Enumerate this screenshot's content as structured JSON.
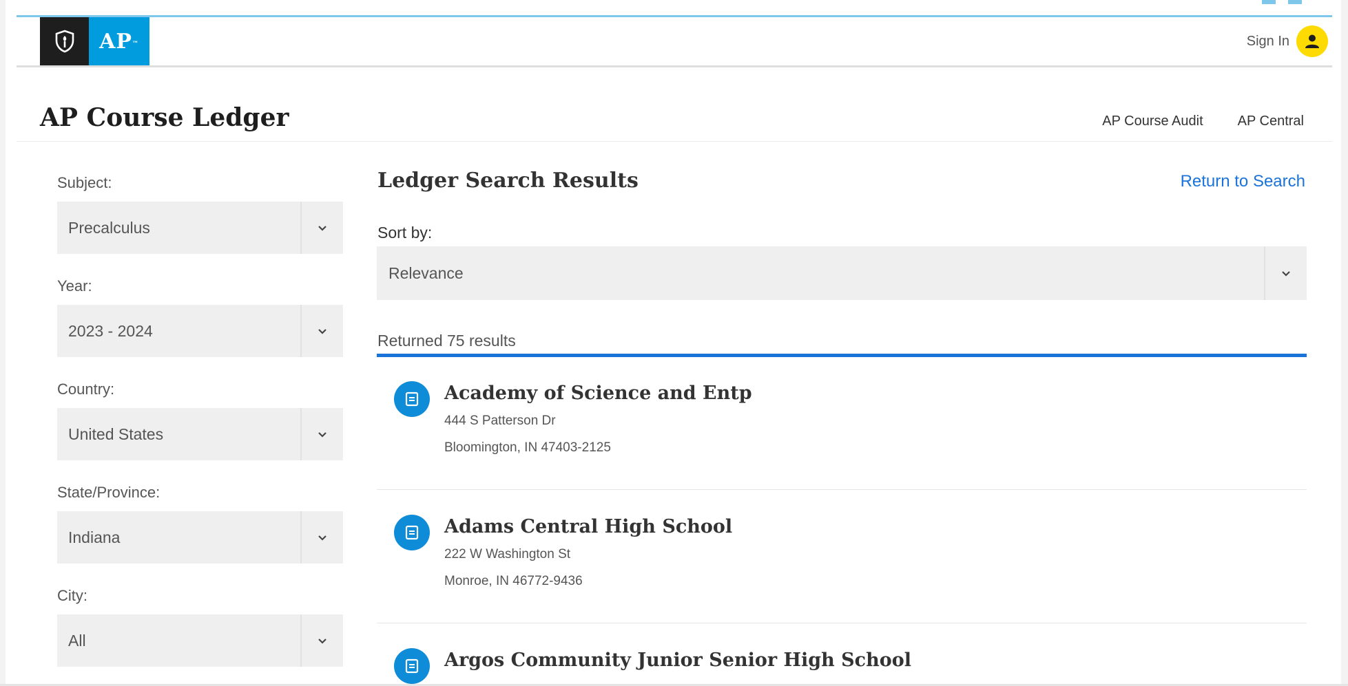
{
  "header": {
    "logo_text": "AP",
    "signin_label": "Sign In"
  },
  "titlebar": {
    "page_title": "AP Course Ledger",
    "links": [
      "AP Course Audit",
      "AP Central"
    ]
  },
  "filters": [
    {
      "label": "Subject:",
      "value": "Precalculus"
    },
    {
      "label": "Year:",
      "value": "2023 - 2024"
    },
    {
      "label": "Country:",
      "value": "United States"
    },
    {
      "label": "State/Province:",
      "value": "Indiana"
    },
    {
      "label": "City:",
      "value": "All"
    }
  ],
  "main": {
    "results_title": "Ledger Search Results",
    "return_link": "Return to Search",
    "sort_label": "Sort by:",
    "sort_value": "Relevance",
    "results_count": "Returned 75 results",
    "results": [
      {
        "name": "Academy of Science and Entp",
        "address1": "444 S Patterson Dr",
        "address2": "Bloomington, IN 47403-2125"
      },
      {
        "name": "Adams Central High School",
        "address1": "222 W Washington St",
        "address2": "Monroe, IN 46772-9436"
      },
      {
        "name": "Argos Community Junior Senior High School",
        "address1": "",
        "address2": ""
      }
    ]
  },
  "colors": {
    "brand_blue": "#009cde",
    "link_blue": "#1a73d9",
    "avatar_yellow": "#fedb00",
    "logo_dark": "#1e1e1e"
  },
  "icons": {
    "logo": "shield-torch-icon",
    "avatar": "user-icon",
    "dropdown": "chevron-down-icon",
    "result": "document-icon"
  }
}
